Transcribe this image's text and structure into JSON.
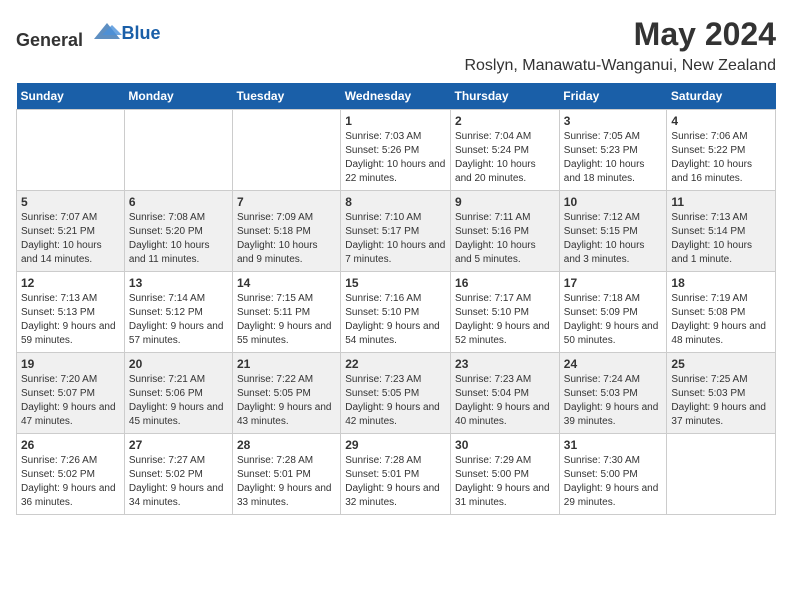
{
  "logo": {
    "general": "General",
    "blue": "Blue"
  },
  "title": "May 2024",
  "subtitle": "Roslyn, Manawatu-Wanganui, New Zealand",
  "weekdays": [
    "Sunday",
    "Monday",
    "Tuesday",
    "Wednesday",
    "Thursday",
    "Friday",
    "Saturday"
  ],
  "weeks": [
    [
      {
        "day": "",
        "info": ""
      },
      {
        "day": "",
        "info": ""
      },
      {
        "day": "",
        "info": ""
      },
      {
        "day": "1",
        "info": "Sunrise: 7:03 AM\nSunset: 5:26 PM\nDaylight: 10 hours and 22 minutes."
      },
      {
        "day": "2",
        "info": "Sunrise: 7:04 AM\nSunset: 5:24 PM\nDaylight: 10 hours and 20 minutes."
      },
      {
        "day": "3",
        "info": "Sunrise: 7:05 AM\nSunset: 5:23 PM\nDaylight: 10 hours and 18 minutes."
      },
      {
        "day": "4",
        "info": "Sunrise: 7:06 AM\nSunset: 5:22 PM\nDaylight: 10 hours and 16 minutes."
      }
    ],
    [
      {
        "day": "5",
        "info": "Sunrise: 7:07 AM\nSunset: 5:21 PM\nDaylight: 10 hours and 14 minutes."
      },
      {
        "day": "6",
        "info": "Sunrise: 7:08 AM\nSunset: 5:20 PM\nDaylight: 10 hours and 11 minutes."
      },
      {
        "day": "7",
        "info": "Sunrise: 7:09 AM\nSunset: 5:18 PM\nDaylight: 10 hours and 9 minutes."
      },
      {
        "day": "8",
        "info": "Sunrise: 7:10 AM\nSunset: 5:17 PM\nDaylight: 10 hours and 7 minutes."
      },
      {
        "day": "9",
        "info": "Sunrise: 7:11 AM\nSunset: 5:16 PM\nDaylight: 10 hours and 5 minutes."
      },
      {
        "day": "10",
        "info": "Sunrise: 7:12 AM\nSunset: 5:15 PM\nDaylight: 10 hours and 3 minutes."
      },
      {
        "day": "11",
        "info": "Sunrise: 7:13 AM\nSunset: 5:14 PM\nDaylight: 10 hours and 1 minute."
      }
    ],
    [
      {
        "day": "12",
        "info": "Sunrise: 7:13 AM\nSunset: 5:13 PM\nDaylight: 9 hours and 59 minutes."
      },
      {
        "day": "13",
        "info": "Sunrise: 7:14 AM\nSunset: 5:12 PM\nDaylight: 9 hours and 57 minutes."
      },
      {
        "day": "14",
        "info": "Sunrise: 7:15 AM\nSunset: 5:11 PM\nDaylight: 9 hours and 55 minutes."
      },
      {
        "day": "15",
        "info": "Sunrise: 7:16 AM\nSunset: 5:10 PM\nDaylight: 9 hours and 54 minutes."
      },
      {
        "day": "16",
        "info": "Sunrise: 7:17 AM\nSunset: 5:10 PM\nDaylight: 9 hours and 52 minutes."
      },
      {
        "day": "17",
        "info": "Sunrise: 7:18 AM\nSunset: 5:09 PM\nDaylight: 9 hours and 50 minutes."
      },
      {
        "day": "18",
        "info": "Sunrise: 7:19 AM\nSunset: 5:08 PM\nDaylight: 9 hours and 48 minutes."
      }
    ],
    [
      {
        "day": "19",
        "info": "Sunrise: 7:20 AM\nSunset: 5:07 PM\nDaylight: 9 hours and 47 minutes."
      },
      {
        "day": "20",
        "info": "Sunrise: 7:21 AM\nSunset: 5:06 PM\nDaylight: 9 hours and 45 minutes."
      },
      {
        "day": "21",
        "info": "Sunrise: 7:22 AM\nSunset: 5:05 PM\nDaylight: 9 hours and 43 minutes."
      },
      {
        "day": "22",
        "info": "Sunrise: 7:23 AM\nSunset: 5:05 PM\nDaylight: 9 hours and 42 minutes."
      },
      {
        "day": "23",
        "info": "Sunrise: 7:23 AM\nSunset: 5:04 PM\nDaylight: 9 hours and 40 minutes."
      },
      {
        "day": "24",
        "info": "Sunrise: 7:24 AM\nSunset: 5:03 PM\nDaylight: 9 hours and 39 minutes."
      },
      {
        "day": "25",
        "info": "Sunrise: 7:25 AM\nSunset: 5:03 PM\nDaylight: 9 hours and 37 minutes."
      }
    ],
    [
      {
        "day": "26",
        "info": "Sunrise: 7:26 AM\nSunset: 5:02 PM\nDaylight: 9 hours and 36 minutes."
      },
      {
        "day": "27",
        "info": "Sunrise: 7:27 AM\nSunset: 5:02 PM\nDaylight: 9 hours and 34 minutes."
      },
      {
        "day": "28",
        "info": "Sunrise: 7:28 AM\nSunset: 5:01 PM\nDaylight: 9 hours and 33 minutes."
      },
      {
        "day": "29",
        "info": "Sunrise: 7:28 AM\nSunset: 5:01 PM\nDaylight: 9 hours and 32 minutes."
      },
      {
        "day": "30",
        "info": "Sunrise: 7:29 AM\nSunset: 5:00 PM\nDaylight: 9 hours and 31 minutes."
      },
      {
        "day": "31",
        "info": "Sunrise: 7:30 AM\nSunset: 5:00 PM\nDaylight: 9 hours and 29 minutes."
      },
      {
        "day": "",
        "info": ""
      }
    ]
  ]
}
